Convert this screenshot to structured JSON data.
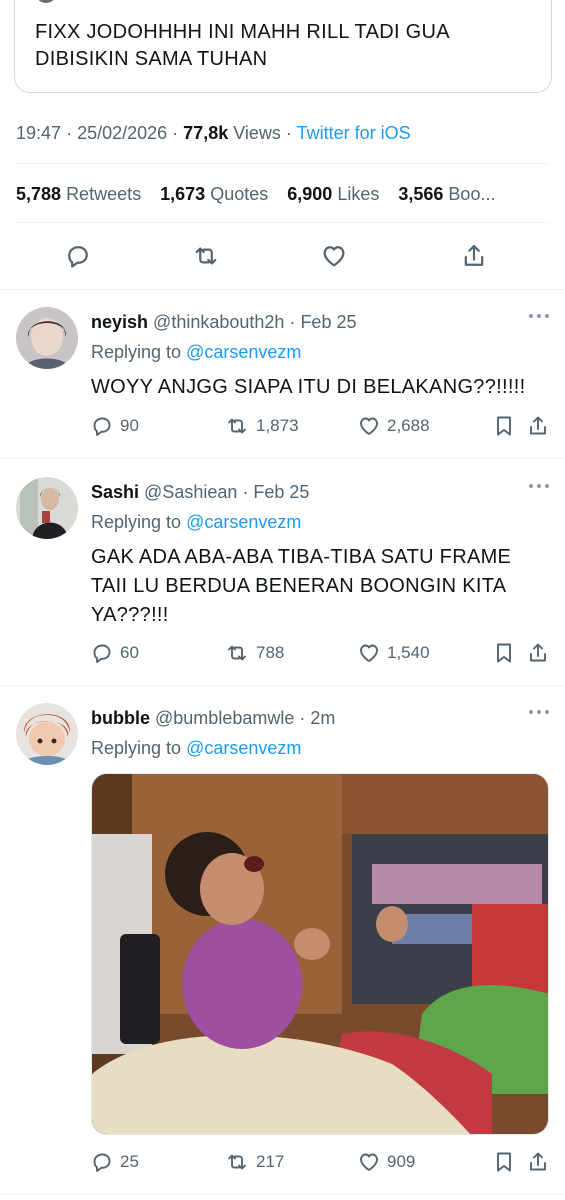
{
  "quoted": {
    "name": "",
    "text": "FIXX JODOHHHH INI MAHH RILL TADI GUA DIBISIKIN SAMA TUHAN"
  },
  "meta": {
    "time": "19:47",
    "date": "25/02/2026",
    "views_count": "77,8k",
    "views_label": "Views",
    "client": "Twitter for iOS"
  },
  "stats": {
    "retweets_count": "5,788",
    "retweets_label": "Retweets",
    "quotes_count": "1,673",
    "quotes_label": "Quotes",
    "likes_count": "6,900",
    "likes_label": "Likes",
    "bookmarks_count": "3,566",
    "bookmarks_label": "Boo..."
  },
  "replies": [
    {
      "name": "neyish",
      "handle": "@thinkabouth2h",
      "time": "Feb 25",
      "replying_label": "Replying to",
      "replying_to": "@carsenvezm",
      "text": "WOYY ANJGG SIAPA ITU DI BELAKANG??!!!!!",
      "replies": "90",
      "retweets": "1,873",
      "likes": "2,688"
    },
    {
      "name": "Sashi",
      "handle": "@Sashiean",
      "time": "Feb 25",
      "replying_label": "Replying to",
      "replying_to": "@carsenvezm",
      "text": "GAK ADA ABA-ABA TIBA-TIBA SATU FRAME TAII LU BERDUA BENERAN BOONGIN KITA YA???!!!",
      "replies": "60",
      "retweets": "788",
      "likes": "1,540"
    },
    {
      "name": "bubble",
      "handle": "@bumblebamwle",
      "time": "2m",
      "replying_label": "Replying to",
      "replying_to": "@carsenvezm",
      "replies": "25",
      "retweets": "217",
      "likes": "909"
    }
  ],
  "colors": {
    "accent": "#1d9bf0",
    "secondary_text": "#536471",
    "primary_text": "#0f1419",
    "divider": "#eff3f4"
  },
  "icons": [
    "reply-icon",
    "retweet-icon",
    "like-icon",
    "share-icon",
    "bookmark-icon",
    "more-icon"
  ]
}
